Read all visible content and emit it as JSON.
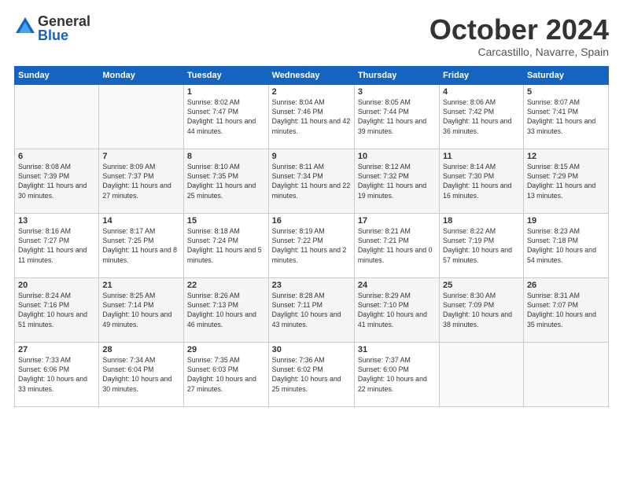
{
  "header": {
    "logo_general": "General",
    "logo_blue": "Blue",
    "month_title": "October 2024",
    "location": "Carcastillo, Navarre, Spain"
  },
  "days_of_week": [
    "Sunday",
    "Monday",
    "Tuesday",
    "Wednesday",
    "Thursday",
    "Friday",
    "Saturday"
  ],
  "weeks": [
    [
      {
        "day": "",
        "info": ""
      },
      {
        "day": "",
        "info": ""
      },
      {
        "day": "1",
        "info": "Sunrise: 8:02 AM\nSunset: 7:47 PM\nDaylight: 11 hours and 44 minutes."
      },
      {
        "day": "2",
        "info": "Sunrise: 8:04 AM\nSunset: 7:46 PM\nDaylight: 11 hours and 42 minutes."
      },
      {
        "day": "3",
        "info": "Sunrise: 8:05 AM\nSunset: 7:44 PM\nDaylight: 11 hours and 39 minutes."
      },
      {
        "day": "4",
        "info": "Sunrise: 8:06 AM\nSunset: 7:42 PM\nDaylight: 11 hours and 36 minutes."
      },
      {
        "day": "5",
        "info": "Sunrise: 8:07 AM\nSunset: 7:41 PM\nDaylight: 11 hours and 33 minutes."
      }
    ],
    [
      {
        "day": "6",
        "info": "Sunrise: 8:08 AM\nSunset: 7:39 PM\nDaylight: 11 hours and 30 minutes."
      },
      {
        "day": "7",
        "info": "Sunrise: 8:09 AM\nSunset: 7:37 PM\nDaylight: 11 hours and 27 minutes."
      },
      {
        "day": "8",
        "info": "Sunrise: 8:10 AM\nSunset: 7:35 PM\nDaylight: 11 hours and 25 minutes."
      },
      {
        "day": "9",
        "info": "Sunrise: 8:11 AM\nSunset: 7:34 PM\nDaylight: 11 hours and 22 minutes."
      },
      {
        "day": "10",
        "info": "Sunrise: 8:12 AM\nSunset: 7:32 PM\nDaylight: 11 hours and 19 minutes."
      },
      {
        "day": "11",
        "info": "Sunrise: 8:14 AM\nSunset: 7:30 PM\nDaylight: 11 hours and 16 minutes."
      },
      {
        "day": "12",
        "info": "Sunrise: 8:15 AM\nSunset: 7:29 PM\nDaylight: 11 hours and 13 minutes."
      }
    ],
    [
      {
        "day": "13",
        "info": "Sunrise: 8:16 AM\nSunset: 7:27 PM\nDaylight: 11 hours and 11 minutes."
      },
      {
        "day": "14",
        "info": "Sunrise: 8:17 AM\nSunset: 7:25 PM\nDaylight: 11 hours and 8 minutes."
      },
      {
        "day": "15",
        "info": "Sunrise: 8:18 AM\nSunset: 7:24 PM\nDaylight: 11 hours and 5 minutes."
      },
      {
        "day": "16",
        "info": "Sunrise: 8:19 AM\nSunset: 7:22 PM\nDaylight: 11 hours and 2 minutes."
      },
      {
        "day": "17",
        "info": "Sunrise: 8:21 AM\nSunset: 7:21 PM\nDaylight: 11 hours and 0 minutes."
      },
      {
        "day": "18",
        "info": "Sunrise: 8:22 AM\nSunset: 7:19 PM\nDaylight: 10 hours and 57 minutes."
      },
      {
        "day": "19",
        "info": "Sunrise: 8:23 AM\nSunset: 7:18 PM\nDaylight: 10 hours and 54 minutes."
      }
    ],
    [
      {
        "day": "20",
        "info": "Sunrise: 8:24 AM\nSunset: 7:16 PM\nDaylight: 10 hours and 51 minutes."
      },
      {
        "day": "21",
        "info": "Sunrise: 8:25 AM\nSunset: 7:14 PM\nDaylight: 10 hours and 49 minutes."
      },
      {
        "day": "22",
        "info": "Sunrise: 8:26 AM\nSunset: 7:13 PM\nDaylight: 10 hours and 46 minutes."
      },
      {
        "day": "23",
        "info": "Sunrise: 8:28 AM\nSunset: 7:11 PM\nDaylight: 10 hours and 43 minutes."
      },
      {
        "day": "24",
        "info": "Sunrise: 8:29 AM\nSunset: 7:10 PM\nDaylight: 10 hours and 41 minutes."
      },
      {
        "day": "25",
        "info": "Sunrise: 8:30 AM\nSunset: 7:09 PM\nDaylight: 10 hours and 38 minutes."
      },
      {
        "day": "26",
        "info": "Sunrise: 8:31 AM\nSunset: 7:07 PM\nDaylight: 10 hours and 35 minutes."
      }
    ],
    [
      {
        "day": "27",
        "info": "Sunrise: 7:33 AM\nSunset: 6:06 PM\nDaylight: 10 hours and 33 minutes."
      },
      {
        "day": "28",
        "info": "Sunrise: 7:34 AM\nSunset: 6:04 PM\nDaylight: 10 hours and 30 minutes."
      },
      {
        "day": "29",
        "info": "Sunrise: 7:35 AM\nSunset: 6:03 PM\nDaylight: 10 hours and 27 minutes."
      },
      {
        "day": "30",
        "info": "Sunrise: 7:36 AM\nSunset: 6:02 PM\nDaylight: 10 hours and 25 minutes."
      },
      {
        "day": "31",
        "info": "Sunrise: 7:37 AM\nSunset: 6:00 PM\nDaylight: 10 hours and 22 minutes."
      },
      {
        "day": "",
        "info": ""
      },
      {
        "day": "",
        "info": ""
      }
    ]
  ]
}
